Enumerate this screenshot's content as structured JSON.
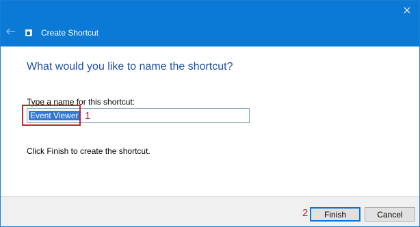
{
  "window": {
    "title": "Create Shortcut"
  },
  "page": {
    "heading": "What would you like to name the shortcut?",
    "prompt_label": "Type a name for this shortcut:",
    "name_value": "Event Viewer",
    "finish_note": "Click Finish to create the shortcut."
  },
  "callouts": {
    "first": "1",
    "second": "2"
  },
  "buttons": {
    "finish": "Finish",
    "cancel": "Cancel"
  },
  "icons": {
    "back": "back-arrow-icon",
    "close": "close-icon",
    "app": "shortcut-icon"
  },
  "colors": {
    "titlebar": "#0a7ad6",
    "heading": "#1f4fa3",
    "selection": "#2f78d6",
    "callout": "#c1272d",
    "default_button_border": "#0a74d9"
  }
}
